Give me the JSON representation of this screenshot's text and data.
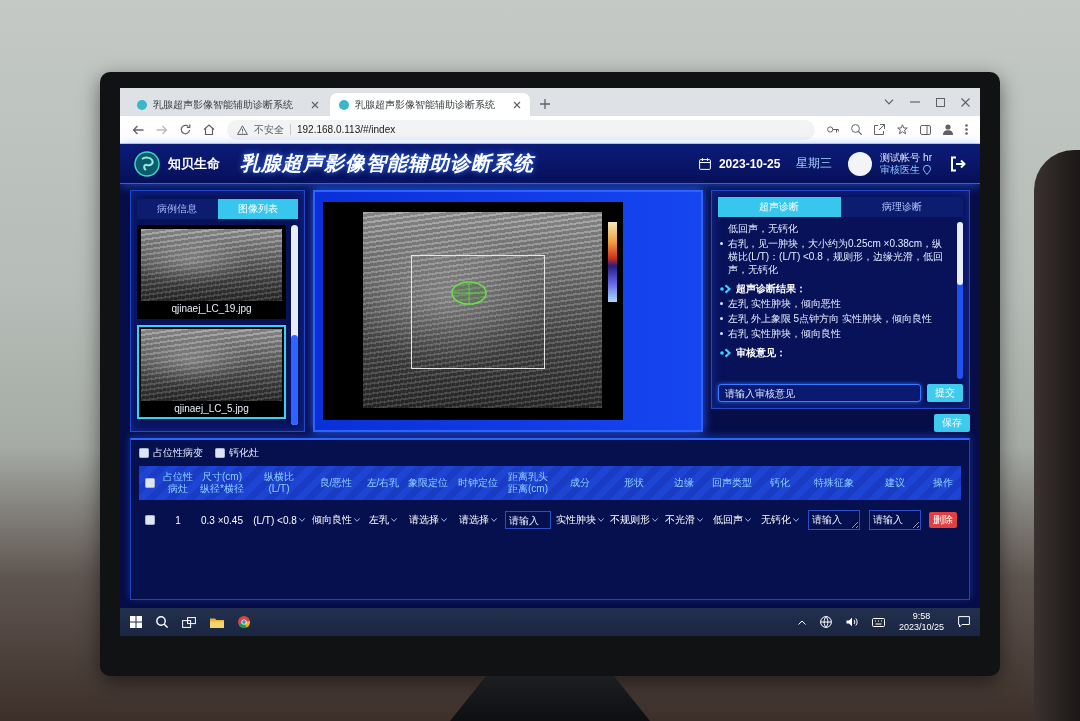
{
  "browser": {
    "tabs": [
      {
        "title": "乳腺超声影像智能辅助诊断系统",
        "selected": false
      },
      {
        "title": "乳腺超声影像智能辅助诊断系统",
        "selected": true
      }
    ],
    "security_label": "不安全",
    "url": "192.168.0.113/#/index"
  },
  "header": {
    "logo_text": "知贝生命",
    "title": "乳腺超声影像智能辅助诊断系统",
    "date": "2023-10-25",
    "weekday": "星期三",
    "user_name": "测试帐号 hr",
    "user_role": "审核医生"
  },
  "image_panel": {
    "tabs": [
      {
        "label": "病例信息",
        "selected": false
      },
      {
        "label": "图像列表",
        "selected": true
      }
    ],
    "images": [
      {
        "file_name": "qjinaej_LC_19.jpg",
        "selected": false
      },
      {
        "file_name": "qjinaej_LC_5.jpg",
        "selected": true
      }
    ]
  },
  "report_panel": {
    "tabs": [
      {
        "label": "超声诊断",
        "selected": true
      },
      {
        "label": "病理诊断",
        "selected": false
      }
    ],
    "findings": [
      {
        "kind": "continuation",
        "text": "低回声，无钙化"
      },
      {
        "kind": "bullet",
        "text": "右乳，见一肿块，大小约为0.25cm ×0.38cm，纵横比(L/T)：(L/T) <0.8，规则形，边缘光滑，低回声，无钙化"
      }
    ],
    "result_heading": "超声诊断结果：",
    "results": [
      "左乳 实性肿块，倾向恶性",
      "左乳 外上象限 5点钟方向 实性肿块，倾向良性",
      "右乳 实性肿块，倾向良性"
    ],
    "review_heading": "审核意见：",
    "review_placeholder": "请输入审核意见",
    "submit_button": "提交",
    "save_button": "保存"
  },
  "lesion_table": {
    "filters": [
      {
        "label": "占位性病变",
        "checked": false
      },
      {
        "label": "钙化灶",
        "checked": false
      }
    ],
    "select_all_checked": false,
    "columns": [
      "占位性病灶",
      "尺寸(cm)纵径*横径",
      "纵横比(L/T)",
      "良/恶性",
      "左/右乳",
      "象限定位",
      "时钟定位",
      "距离乳头距离(cm)",
      "成分",
      "形状",
      "边缘",
      "回声类型",
      "钙化",
      "特殊征象",
      "建议",
      "操作"
    ],
    "rows": [
      {
        "checked": false,
        "cells": [
          {
            "kind": "text",
            "text": "1"
          },
          {
            "kind": "text",
            "text": "0.3 ×0.45"
          },
          {
            "kind": "select",
            "value": "(L/T) <0.8"
          },
          {
            "kind": "select",
            "value": "倾向良性"
          },
          {
            "kind": "select",
            "value": "左乳"
          },
          {
            "kind": "select",
            "value": "请选择"
          },
          {
            "kind": "select",
            "value": "请选择"
          },
          {
            "kind": "input",
            "placeholder": "请输入"
          },
          {
            "kind": "select",
            "value": "实性肿块"
          },
          {
            "kind": "select",
            "value": "不规则形"
          },
          {
            "kind": "select",
            "value": "不光滑"
          },
          {
            "kind": "select",
            "value": "低回声"
          },
          {
            "kind": "select",
            "value": "无钙化"
          },
          {
            "kind": "textarea",
            "placeholder": "请输入"
          },
          {
            "kind": "textarea",
            "placeholder": "请输入"
          },
          {
            "kind": "button",
            "label": "删除"
          }
        ]
      }
    ]
  },
  "taskbar": {
    "time": "9:58",
    "date": "2023/10/25"
  }
}
